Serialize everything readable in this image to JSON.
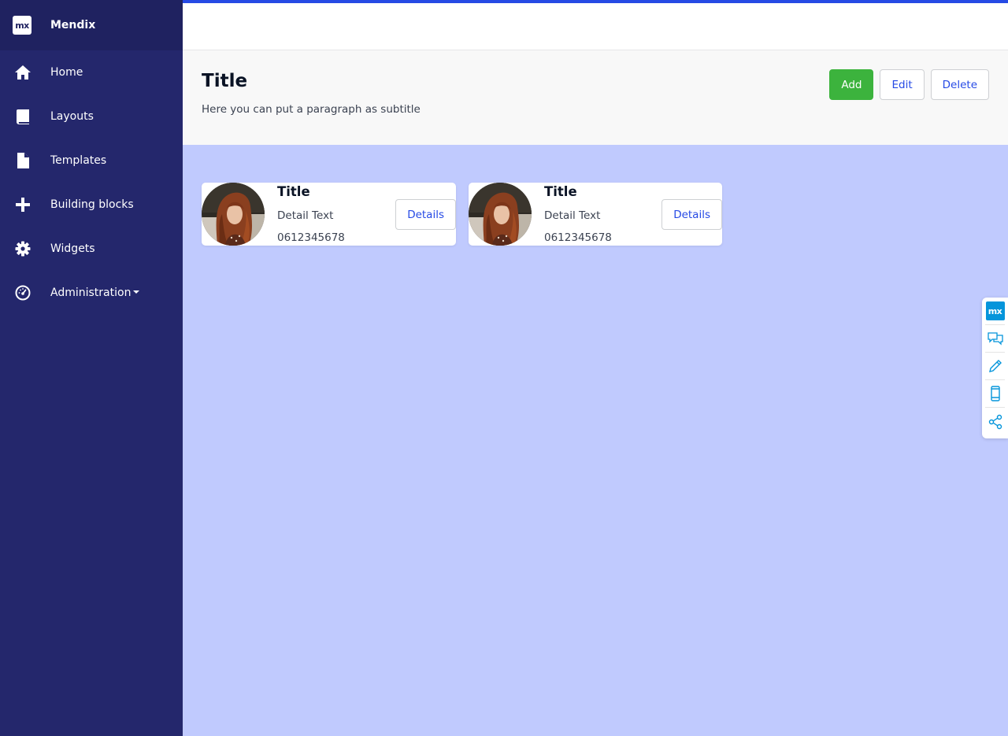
{
  "brand": {
    "logo_text": "mx",
    "name": "Mendix"
  },
  "sidebar": {
    "items": [
      {
        "label": "Home",
        "icon": "home-icon"
      },
      {
        "label": "Layouts",
        "icon": "book-icon"
      },
      {
        "label": "Templates",
        "icon": "file-icon"
      },
      {
        "label": "Building blocks",
        "icon": "plus-icon"
      },
      {
        "label": "Widgets",
        "icon": "gear-icon"
      },
      {
        "label": "Administration",
        "icon": "dashboard-icon",
        "has_dropdown": true
      }
    ]
  },
  "header": {
    "title": "Title",
    "subtitle": "Here you can put a paragraph as subtitle",
    "actions": {
      "add_label": "Add",
      "edit_label": "Edit",
      "delete_label": "Delete"
    }
  },
  "cards": [
    {
      "title": "Title",
      "detail": "Detail Text",
      "phone": "0612345678",
      "button_label": "Details"
    },
    {
      "title": "Title",
      "detail": "Detail Text",
      "phone": "0612345678",
      "button_label": "Details"
    }
  ],
  "float_toolbar": {
    "logo_text": "mx",
    "items": [
      "mx-logo-icon",
      "chat-icon",
      "pencil-icon",
      "mobile-icon",
      "share-icon"
    ]
  },
  "colors": {
    "sidebar_bg": "#24276c",
    "brand_bg": "#1f2260",
    "accent": "#264ae5",
    "success": "#3cb33d",
    "content_bg": "#c0cafe",
    "float_accent": "#0595db"
  }
}
